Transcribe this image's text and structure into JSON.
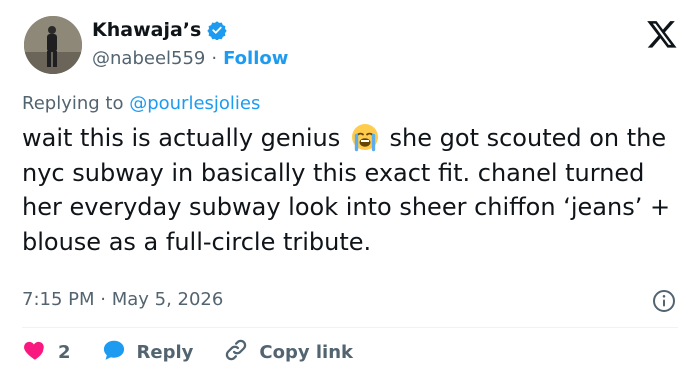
{
  "author": {
    "display_name": "Khawaja’s",
    "handle": "@nabeel559",
    "separator": "·",
    "follow_label": "Follow"
  },
  "reply": {
    "prefix": "Replying to ",
    "mention": "@pourlesjolies"
  },
  "tweet": {
    "text_before_emoji": "wait this is actually genius",
    "emoji": "loudly-crying-face",
    "text_after_emoji": " she got scouted on the nyc subway in basically this exact fit. chanel turned her everyday subway look into sheer chiffon ‘jeans’ + blouse as a full-circle tribute."
  },
  "meta": {
    "timestamp": "7:15 PM · May 5, 2026"
  },
  "actions": {
    "like_count": "2",
    "reply_label": "Reply",
    "copy_link_label": "Copy link"
  },
  "colors": {
    "accent": "#1d9bf0",
    "like": "#f91880",
    "text": "#0f1419",
    "muted": "#536471"
  },
  "icons": [
    "verified-badge-icon",
    "x-logo-icon",
    "info-icon",
    "heart-icon",
    "reply-bubble-icon",
    "link-icon"
  ]
}
